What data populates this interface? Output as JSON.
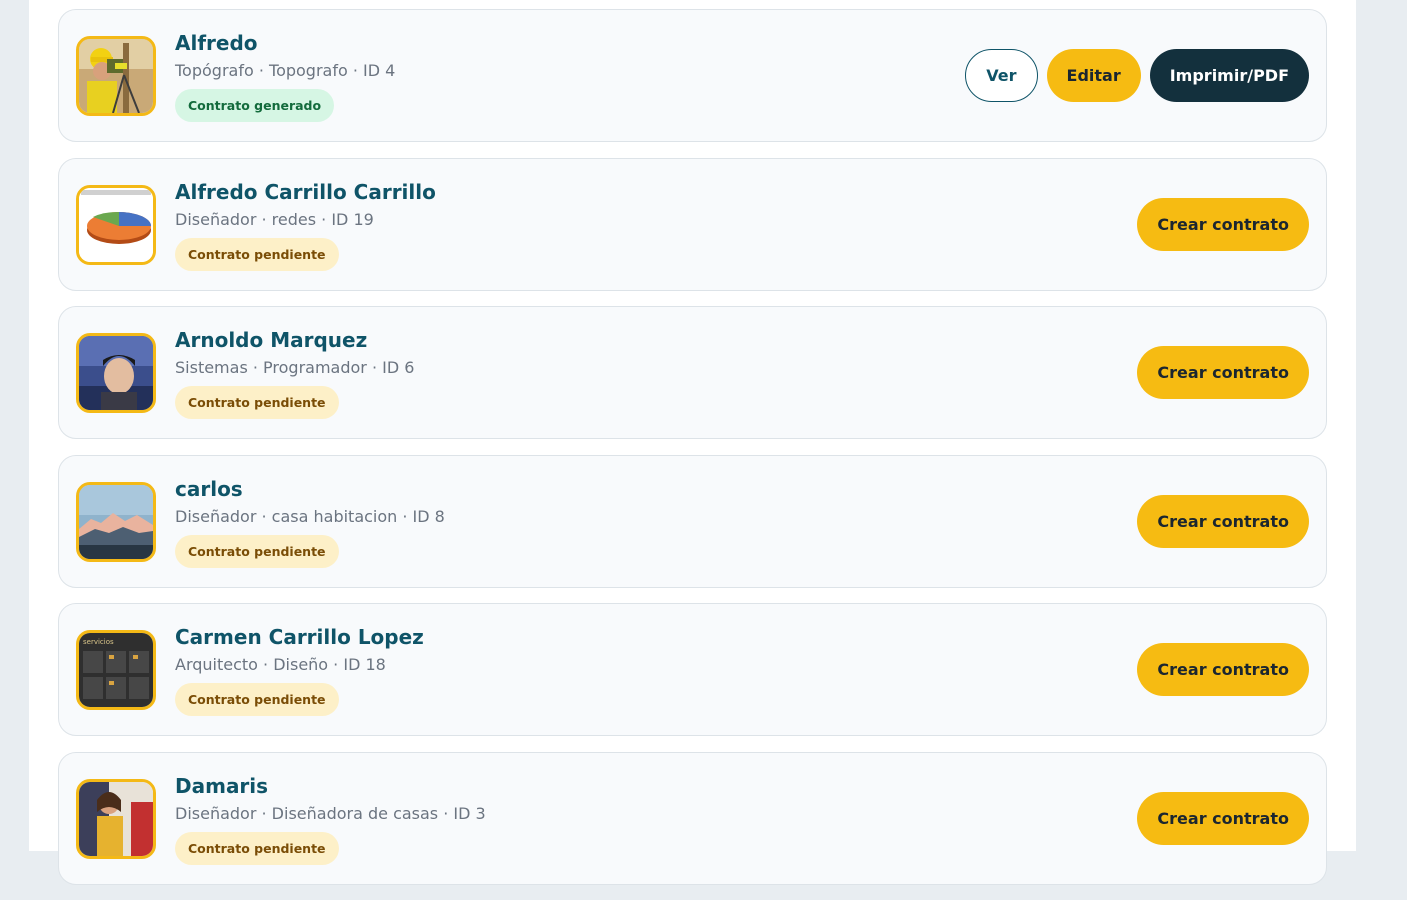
{
  "employees": [
    {
      "name": "Alfredo",
      "meta": "Topógrafo · Topografo · ID 4",
      "status": "Contrato generado",
      "avatar": "surveyor-photo",
      "actions": {
        "ver": "Ver",
        "edit": "Editar",
        "print": "Imprimir/PDF"
      }
    },
    {
      "name": "Alfredo Carrillo Carrillo",
      "meta": "Diseñador · redes · ID 19",
      "status": "Contrato pendiente",
      "avatar": "pie-chart-image",
      "actions": {
        "create": "Crear contrato"
      }
    },
    {
      "name": "Arnoldo Marquez",
      "meta": "Sistemas · Programador · ID 6",
      "status": "Contrato pendiente",
      "avatar": "portrait-photo",
      "actions": {
        "create": "Crear contrato"
      }
    },
    {
      "name": "carlos",
      "meta": "Diseñador · casa habitacion · ID 8",
      "status": "Contrato pendiente",
      "avatar": "mountain-photo",
      "actions": {
        "create": "Crear contrato"
      }
    },
    {
      "name": "Carmen Carrillo Lopez",
      "meta": "Arquitecto · Diseño · ID 18",
      "status": "Contrato pendiente",
      "avatar": "services-screenshot",
      "avatar_text": "servicios",
      "actions": {
        "create": "Crear contrato"
      }
    },
    {
      "name": "Damaris",
      "meta": "Diseñador · Diseñadora de casas · ID 3",
      "status": "Contrato pendiente",
      "avatar": "woman-photo",
      "actions": {
        "create": "Crear contrato"
      }
    }
  ],
  "colors": {
    "name": "#0f5468",
    "accent_yellow": "#f6bb12",
    "dark_button": "#13303d",
    "badge_generated_bg": "#d6f6e4",
    "badge_pending_bg": "#fdf0c8"
  }
}
